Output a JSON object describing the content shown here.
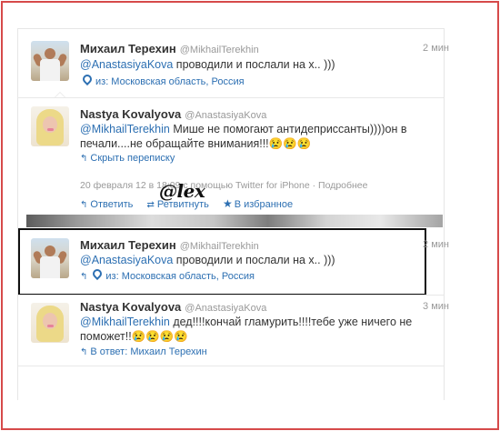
{
  "tweets": [
    {
      "author": "Михаил Терехин",
      "handle": "@MikhailTerekhin",
      "time": "2 мин",
      "mention": "@AnastasiyaKova",
      "text": " проводили и послали на х.. )))",
      "location": "из: Московская область, Россия"
    },
    {
      "author": "Nastya Kovalyova",
      "handle": "@AnastasiyaKova",
      "mention": "@MikhailTerekhin",
      "text": " Мише не помогают антидеприссанты))))он в печали....не обращайте внимания!!!😢😢😢",
      "hide_conversation": "Скрыть переписку",
      "details": "20 февраля 12 в 18:09 с помощью Twitter for iPhone · Подробнее",
      "actions": {
        "reply": "Ответить",
        "retweet": "Ретвитнуть",
        "favorite": "В избранное"
      }
    },
    {
      "author": "Михаил Терехин",
      "handle": "@MikhailTerekhin",
      "time": "2 мин",
      "mention": "@AnastasiyaKova",
      "text": " проводили и послали на х.. )))",
      "location": "из: Московская область, Россия"
    },
    {
      "author": "Nastya Kovalyova",
      "handle": "@AnastasiyaKova",
      "time": "3 мин",
      "mention": "@MikhailTerekhin",
      "text": " дед!!!!кончай гламурить!!!!тебе уже ничего не поможет!!😢😢😢😢",
      "in_reply_to": "В ответ: Михаил Терехин"
    }
  ],
  "watermark": "@lex",
  "colors": {
    "link": "#2c6fb2",
    "frame": "#d64a4a",
    "highlight_border": "#111111"
  },
  "icons": {
    "reply": "reply-arrow-icon",
    "retweet": "retweet-icon",
    "favorite": "star-icon",
    "location": "location-pin-icon"
  }
}
